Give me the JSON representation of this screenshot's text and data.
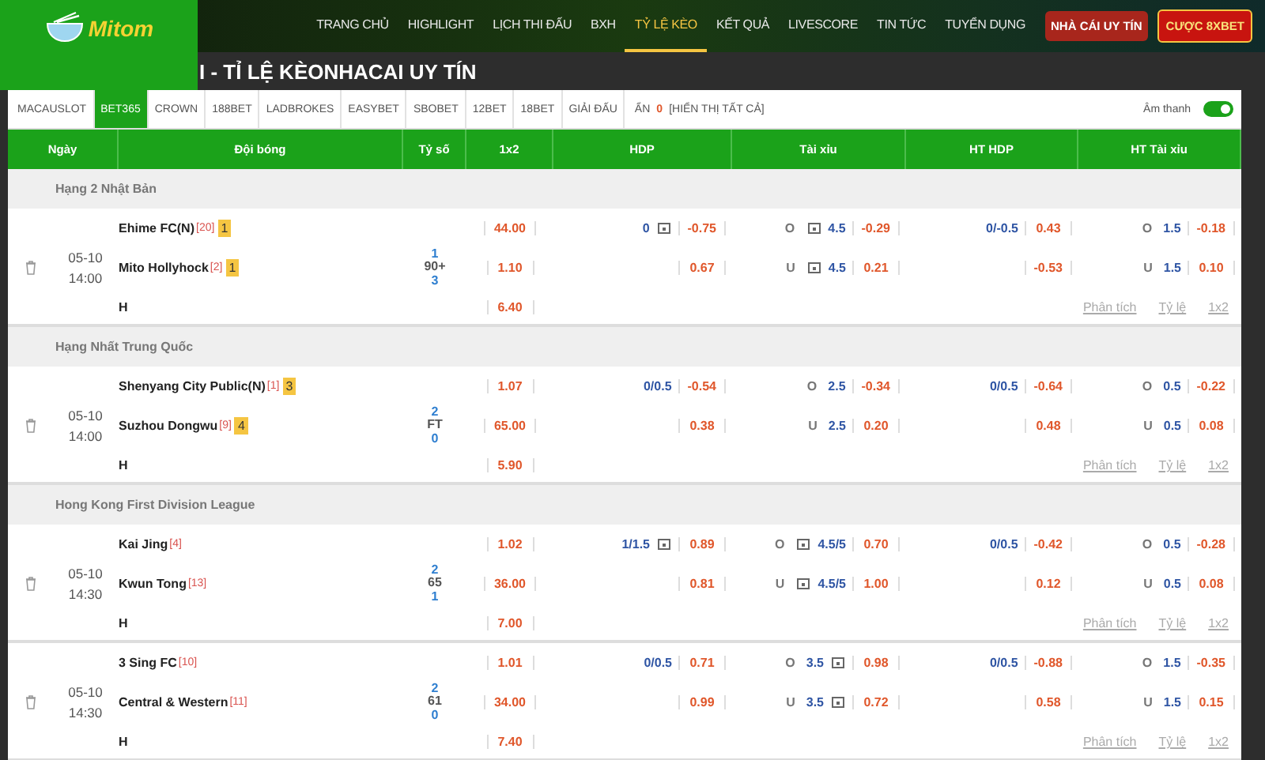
{
  "logo": {
    "text": "Mitom"
  },
  "nav": [
    {
      "label": "TRANG CHỦ",
      "selected": false
    },
    {
      "label": "HIGHLIGHT",
      "selected": false
    },
    {
      "label": "LỊCH THI ĐẤU",
      "selected": false
    },
    {
      "label": "BXH",
      "selected": false
    },
    {
      "label": "TỶ LỆ KÈO",
      "selected": true
    },
    {
      "label": "KẾT QUẢ",
      "selected": false
    },
    {
      "label": "LIVESCORE",
      "selected": false
    },
    {
      "label": "TIN TỨC",
      "selected": false
    },
    {
      "label": "TUYỂN DỤNG",
      "selected": false
    }
  ],
  "nav_buttons": [
    {
      "label": "NHÀ CÁI UY TÍN",
      "kind": "plain"
    },
    {
      "label": "CƯỢC 8XBET",
      "kind": "gold"
    }
  ],
  "page_title": "I - TỈ LỆ KÈONHACAI UY TÍN",
  "tabs": [
    {
      "label": "MACAUSLOT",
      "selected": false
    },
    {
      "label": "BET365",
      "selected": true
    },
    {
      "label": "CROWN",
      "selected": false
    },
    {
      "label": "188BET",
      "selected": false
    },
    {
      "label": "LADBROKES",
      "selected": false
    },
    {
      "label": "EASYBET",
      "selected": false
    },
    {
      "label": "SBOBET",
      "selected": false
    },
    {
      "label": "12BET",
      "selected": false
    },
    {
      "label": "18BET",
      "selected": false
    },
    {
      "label": "GIẢI ĐẤU",
      "selected": false
    }
  ],
  "hidden": {
    "label": "ẨN",
    "count": "0",
    "show_all": "[HIỂN THỊ TẤT CẢ]"
  },
  "sound": {
    "label": "Âm thanh",
    "on": true
  },
  "columns": [
    "Ngày",
    "Đội bóng",
    "Tỷ số",
    "1x2",
    "HDP",
    "Tài xỉu",
    "HT HDP",
    "HT Tài xỉu"
  ],
  "leagues": [
    {
      "name": "Hạng 2 Nhật Bản",
      "matches": [
        {
          "date": "05-10",
          "time": "14:00",
          "home": {
            "name": "Ehime FC(N)",
            "rank": "[20]",
            "cards": "1"
          },
          "away": {
            "name": "Mito Hollyhock",
            "rank": "[2]",
            "cards": "1"
          },
          "draw": "H",
          "score": {
            "home": "1",
            "status": "90+",
            "away": "3"
          },
          "odds_1x2": [
            "44.00",
            "1.10",
            "6.40"
          ],
          "hdp": [
            {
              "line": "0",
              "odds": "-0.75",
              "mark_after": true
            },
            {
              "odds": "0.67"
            }
          ],
          "ou": [
            {
              "side": "O",
              "line": "4.5",
              "odds": "-0.29",
              "mark_before": true
            },
            {
              "side": "U",
              "line": "4.5",
              "odds": "0.21",
              "mark_before": true
            }
          ],
          "ht_hdp": [
            {
              "line": "0/-0.5",
              "odds": "0.43"
            },
            {
              "odds": "-0.53"
            }
          ],
          "ht_ou": [
            {
              "side": "O",
              "line": "1.5",
              "odds": "-0.18"
            },
            {
              "side": "U",
              "line": "1.5",
              "odds": "0.10"
            }
          ],
          "links": [
            "Phân tích",
            "Tỷ lệ",
            "1x2"
          ]
        }
      ]
    },
    {
      "name": "Hạng Nhất Trung Quốc",
      "matches": [
        {
          "date": "05-10",
          "time": "14:00",
          "home": {
            "name": "Shenyang City Public(N)",
            "rank": "[1]",
            "cards": "3"
          },
          "away": {
            "name": "Suzhou Dongwu",
            "rank": "[9]",
            "cards": "4"
          },
          "draw": "H",
          "score": {
            "home": "2",
            "status": "FT",
            "away": "0"
          },
          "odds_1x2": [
            "1.07",
            "65.00",
            "5.90"
          ],
          "hdp": [
            {
              "line": "0/0.5",
              "odds": "-0.54"
            },
            {
              "odds": "0.38"
            }
          ],
          "ou": [
            {
              "side": "O",
              "line": "2.5",
              "odds": "-0.34"
            },
            {
              "side": "U",
              "line": "2.5",
              "odds": "0.20"
            }
          ],
          "ht_hdp": [
            {
              "line": "0/0.5",
              "odds": "-0.64"
            },
            {
              "odds": "0.48"
            }
          ],
          "ht_ou": [
            {
              "side": "O",
              "line": "0.5",
              "odds": "-0.22"
            },
            {
              "side": "U",
              "line": "0.5",
              "odds": "0.08"
            }
          ],
          "links": [
            "Phân tích",
            "Tỷ lệ",
            "1x2"
          ]
        }
      ]
    },
    {
      "name": "Hong Kong First Division League",
      "matches": [
        {
          "date": "05-10",
          "time": "14:30",
          "home": {
            "name": "Kai Jing",
            "rank": "[4]"
          },
          "away": {
            "name": "Kwun Tong",
            "rank": "[13]"
          },
          "draw": "H",
          "score": {
            "home": "2",
            "status": "65",
            "away": "1"
          },
          "odds_1x2": [
            "1.02",
            "36.00",
            "7.00"
          ],
          "hdp": [
            {
              "line": "1/1.5",
              "odds": "0.89",
              "mark_after": true
            },
            {
              "odds": "0.81"
            }
          ],
          "ou": [
            {
              "side": "O",
              "line": "4.5/5",
              "odds": "0.70",
              "mark_before": true
            },
            {
              "side": "U",
              "line": "4.5/5",
              "odds": "1.00",
              "mark_before": true
            }
          ],
          "ht_hdp": [
            {
              "line": "0/0.5",
              "odds": "-0.42"
            },
            {
              "odds": "0.12"
            }
          ],
          "ht_ou": [
            {
              "side": "O",
              "line": "0.5",
              "odds": "-0.28"
            },
            {
              "side": "U",
              "line": "0.5",
              "odds": "0.08"
            }
          ],
          "links": [
            "Phân tích",
            "Tỷ lệ",
            "1x2"
          ]
        },
        {
          "date": "05-10",
          "time": "14:30",
          "home": {
            "name": "3 Sing FC",
            "rank": "[10]"
          },
          "away": {
            "name": "Central & Western",
            "rank": "[11]"
          },
          "draw": "H",
          "score": {
            "home": "2",
            "status": "61",
            "away": "0"
          },
          "odds_1x2": [
            "1.01",
            "34.00",
            "7.40"
          ],
          "hdp": [
            {
              "line": "0/0.5",
              "odds": "0.71"
            },
            {
              "odds": "0.99"
            }
          ],
          "ou": [
            {
              "side": "O",
              "line": "3.5",
              "odds": "0.98",
              "mark_after": true
            },
            {
              "side": "U",
              "line": "3.5",
              "odds": "0.72",
              "mark_after": true
            }
          ],
          "ht_hdp": [
            {
              "line": "0/0.5",
              "odds": "-0.88"
            },
            {
              "odds": "0.58"
            }
          ],
          "ht_ou": [
            {
              "side": "O",
              "line": "1.5",
              "odds": "-0.35"
            },
            {
              "side": "U",
              "line": "1.5",
              "odds": "0.15"
            }
          ],
          "links": [
            "Phân tích",
            "Tỷ lệ",
            "1x2"
          ]
        }
      ]
    }
  ]
}
